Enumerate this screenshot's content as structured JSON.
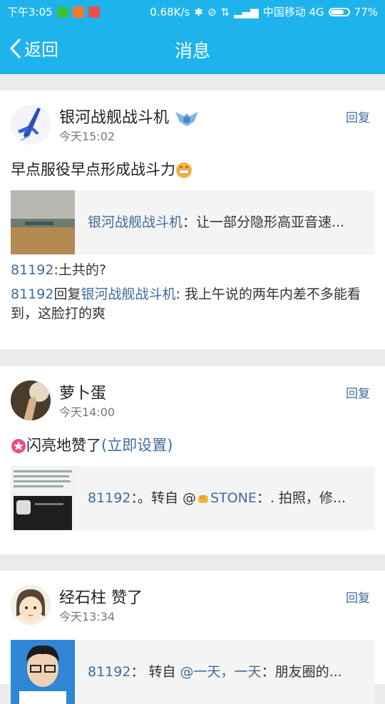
{
  "status_bar": {
    "time": "下午3:05",
    "net_speed": "0.68K/s",
    "carrier": "中国移动 4G",
    "battery": "77%",
    "battery_level": 0.77
  },
  "nav": {
    "back_label": "返回",
    "title": "消息"
  },
  "messages": [
    {
      "name": "银河战舰战斗机",
      "time": "今天15:02",
      "reply": "回复",
      "content": "早点服役早点形成战斗力",
      "quote_author": "银河战舰战斗机",
      "quote_sep": "：",
      "quote_text": "让一部分隐形高亚音速...",
      "comments": [
        {
          "user": "81192",
          "text": ":土共的?"
        },
        {
          "user": "81192",
          "mid": "回复",
          "target": "银河战舰战斗机",
          "text": ": 我上午说的两年内差不多能看到，这脸打的爽"
        }
      ]
    },
    {
      "name": "萝卜蛋",
      "time": "今天14:00",
      "reply": "回复",
      "content_prefix": "闪亮地赞了",
      "content_link": "(立即设置)",
      "quote_user": "81192",
      "quote_text_a": "：。转自 @",
      "quote_user2": "STONE",
      "quote_text_b": "：. 拍照，修..."
    },
    {
      "name": "经石柱",
      "name_suffix": "赞了",
      "time": "今天13:34",
      "reply": "回复",
      "quote_user": "81192",
      "quote_text_a": "：  转自 ",
      "quote_user2": "@一天，一天",
      "quote_text_b": "：朋友圈的..."
    }
  ],
  "colors": {
    "accent": "#1fb3ec",
    "link": "#3f6c9d",
    "background": "#ebebeb"
  }
}
